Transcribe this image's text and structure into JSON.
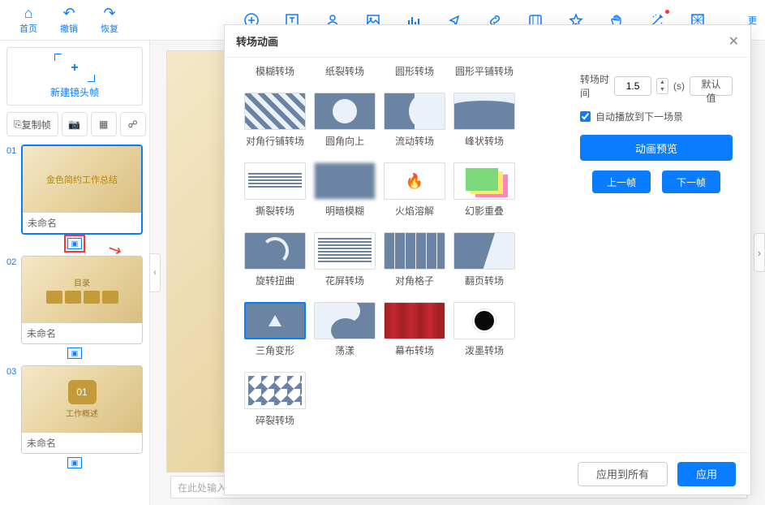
{
  "topbar": {
    "home": "首页",
    "undo": "撤销",
    "redo": "恢复",
    "more": "更"
  },
  "sidebar": {
    "new_frame": "新建镜头帧",
    "copy_frame": "复制帧",
    "slides": [
      {
        "num": "01",
        "name": "未命名",
        "thumb_text": "金色简约工作总结"
      },
      {
        "num": "02",
        "name": "未命名",
        "thumb_text": "目录"
      },
      {
        "num": "03",
        "name": "未命名",
        "thumb_text": "工作概述",
        "big": "01"
      }
    ]
  },
  "canvas": {
    "placeholder": "在此处输入您"
  },
  "modal": {
    "title": "转场动画",
    "time_label": "转场时间",
    "time_value": "1.5",
    "time_unit": "(s)",
    "default_btn": "默认值",
    "autoplay": "自动播放到下一场景",
    "preview": "动画预览",
    "prev": "上一帧",
    "next": "下一帧",
    "apply_all": "应用到所有",
    "apply": "应用",
    "transitions": [
      {
        "label": "模糊转场",
        "cls": "nothumb"
      },
      {
        "label": "纸裂转场",
        "cls": "nothumb"
      },
      {
        "label": "圆形转场",
        "cls": "nothumb"
      },
      {
        "label": "圆形平铺转场",
        "cls": "nothumb"
      },
      {
        "label": "对角行铺转场",
        "cls": "stripes"
      },
      {
        "label": "圆角向上",
        "cls": "circle"
      },
      {
        "label": "流动转场",
        "cls": "flow"
      },
      {
        "label": "峰状转场",
        "cls": "wave"
      },
      {
        "label": "撕裂转场",
        "cls": "tear"
      },
      {
        "label": "明暗模糊",
        "cls": "blur"
      },
      {
        "label": "火焰溶解",
        "cls": "fire"
      },
      {
        "label": "幻影重叠",
        "cls": "phantom"
      },
      {
        "label": "旋转扭曲",
        "cls": "swirl"
      },
      {
        "label": "花屏转场",
        "cls": "lines"
      },
      {
        "label": "对角格子",
        "cls": "grid-diag"
      },
      {
        "label": "翻页转场",
        "cls": "page"
      },
      {
        "label": "三角变形",
        "cls": "tri",
        "sel": true
      },
      {
        "label": "荡漾",
        "cls": "sshape"
      },
      {
        "label": "幕布转场",
        "cls": "curtain"
      },
      {
        "label": "泼墨转场",
        "cls": "ink"
      },
      {
        "label": "碎裂转场",
        "cls": "shatter"
      }
    ]
  }
}
